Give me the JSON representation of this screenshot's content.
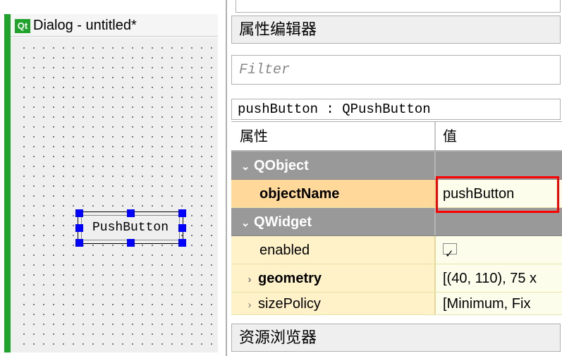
{
  "canvas": {
    "qt_badge": "Qt",
    "title": "Dialog - untitled*",
    "button_text": "PushButton"
  },
  "propeditor": {
    "header": "属性编辑器",
    "filter_placeholder": "Filter",
    "object_label": "pushButton : QPushButton",
    "columns": {
      "name": "属性",
      "value": "值"
    },
    "groups": [
      {
        "name": "QObject",
        "expanded": true,
        "rows": [
          {
            "name": "objectName",
            "value": "pushButton",
            "highlight": true,
            "bold": true
          }
        ]
      },
      {
        "name": "QWidget",
        "expanded": true,
        "rows": [
          {
            "name": "enabled",
            "value_type": "check",
            "checked": true
          },
          {
            "name": "geometry",
            "value": "[(40, 110), 75 x",
            "bold": true,
            "expandable": true
          },
          {
            "name": "sizePolicy",
            "value": "[Minimum, Fix",
            "expandable": true
          }
        ]
      }
    ]
  },
  "resource_browser": {
    "header": "资源浏览器"
  }
}
